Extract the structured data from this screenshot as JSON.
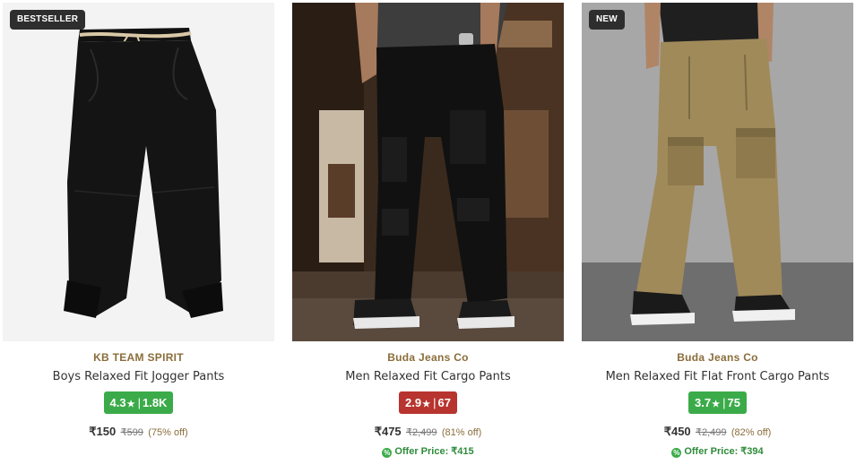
{
  "products": [
    {
      "badge": "BESTSELLER",
      "brand": "KB TEAM SPIRIT",
      "title": "Boys Relaxed Fit Jogger Pants",
      "rating": "4.3",
      "reviews": "1.8K",
      "rating_color": "#3bab49",
      "price": "₹150",
      "mrp": "₹599",
      "discount": "(75% off)",
      "offer": ""
    },
    {
      "badge": "",
      "brand": "Buda Jeans Co",
      "title": "Men Relaxed Fit Cargo Pants",
      "rating": "2.9",
      "reviews": "67",
      "rating_color": "#b7342f",
      "price": "₹475",
      "mrp": "₹2,499",
      "discount": "(81% off)",
      "offer": "Offer Price: ₹415"
    },
    {
      "badge": "NEW",
      "brand": "Buda Jeans Co",
      "title": "Men Relaxed Fit Flat Front Cargo Pants",
      "rating": "3.7",
      "reviews": "75",
      "rating_color": "#3bab49",
      "price": "₹450",
      "mrp": "₹2,499",
      "discount": "(82% off)",
      "offer": "Offer Price: ₹394"
    }
  ],
  "icons": {
    "star": "star-icon",
    "offer": "percent-tag-icon"
  }
}
